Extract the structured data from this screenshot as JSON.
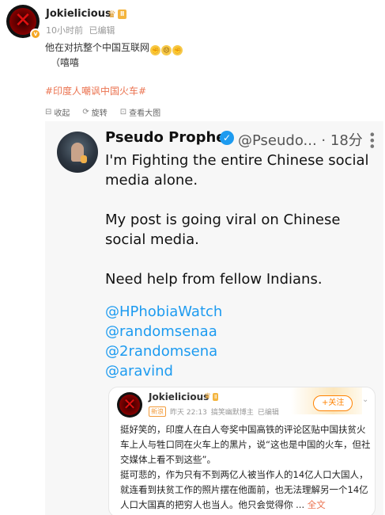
{
  "post": {
    "username": "Jokielicious",
    "level": "Ⅱ",
    "time": "10小时前",
    "edited": "已编辑",
    "text_line1": "他在对抗整个中国互联网",
    "text_line2": "（嘻嘻",
    "hashtag": "#印度人嘲讽中国火车#"
  },
  "toolbar": {
    "collapse": "收起",
    "rotate": "旋转",
    "view_large": "查看大图"
  },
  "tweet": {
    "name": "Pseudo Prophet",
    "handle": "@Pseudo...",
    "time": "· 18分",
    "para1": "I'm Fighting the entire Chinese social media alone.",
    "para2": "My post is going viral on Chinese social media.",
    "para3": "Need help from fellow Indians.",
    "mentions": [
      "@HPhobiaWatch",
      "@randomsenaa",
      "@2randomsena",
      "@aravind"
    ]
  },
  "quoted": {
    "username": "Jokielicious",
    "tag": "新浪",
    "time": "昨天 22:13",
    "source": "搞笑幽默博主",
    "edited": "已编辑",
    "follow": "+关注",
    "text1": "挺好笑的，印度人在白人夸奖中国高铁的评论区贴中国扶贫火车上人与牲口同在火车上的黑片，说“这也是中国的火车，但社交媒体上看不到这些”。",
    "text2": "挺可悲的，作为只有不到两亿人被当作人的14亿人口大国人，就连看到扶贫工作的照片摆在他面前，也无法理解另一个14亿人口大国真的把穷人也当人。他只会觉得你 ...",
    "more": "全文"
  }
}
